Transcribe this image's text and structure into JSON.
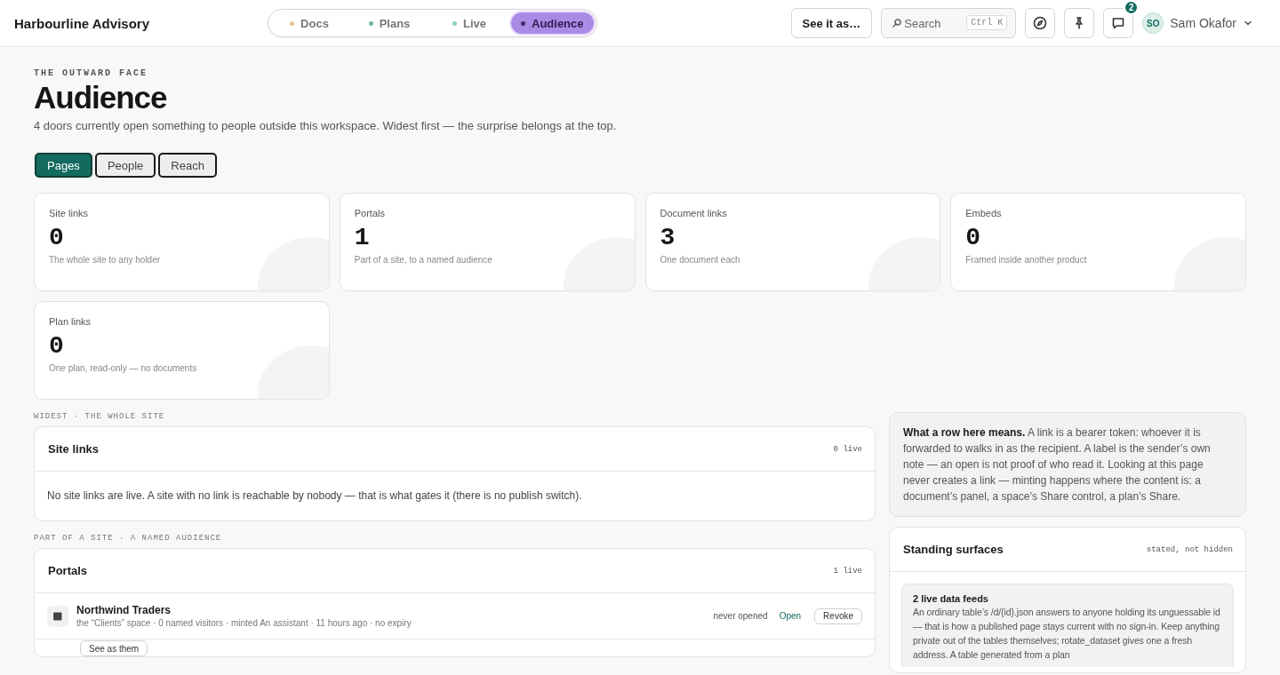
{
  "app": {
    "title": "Harbourline Advisory"
  },
  "nav_tabs": [
    {
      "label": "Docs",
      "selected": false,
      "color": "#e6c98c"
    },
    {
      "label": "Plans",
      "selected": false,
      "color": "#6fb8a3"
    },
    {
      "label": "Live",
      "selected": false,
      "color": "#86d3bd"
    },
    {
      "label": "Audience",
      "selected": true,
      "color": "#3b2a63"
    }
  ],
  "toolbar": {
    "see_as_button": "See it as…",
    "search": {
      "placeholder": "Search",
      "shortcut": "Ctrl K"
    },
    "notification_count": "2",
    "user": {
      "initials": "SO",
      "name": "Sam Okafor"
    }
  },
  "page": {
    "eyebrow": "THE OUTWARD FACE",
    "title": "Audience",
    "subtitle": "4 doors currently open something to people outside this workspace. Widest first — the surprise belongs at the top."
  },
  "view_tabs": [
    {
      "label": "Pages",
      "selected": true
    },
    {
      "label": "People",
      "selected": false
    },
    {
      "label": "Reach",
      "selected": false
    }
  ],
  "stats": [
    {
      "label": "Site links",
      "value": "0",
      "caption": "The whole site to any holder"
    },
    {
      "label": "Portals",
      "value": "1",
      "caption": "Part of a site, to a named audience"
    },
    {
      "label": "Document links",
      "value": "3",
      "caption": "One document each"
    },
    {
      "label": "Embeds",
      "value": "0",
      "caption": "Framed inside another product"
    },
    {
      "label": "Plan links",
      "value": "0",
      "caption": "One plan, read-only — no documents"
    }
  ],
  "sections": [
    {
      "eyebrow": "WIDEST · THE WHOLE SITE",
      "title": "Site links",
      "count": "0 live",
      "kind": "text",
      "body": "No site links are live. A site with no link is reachable by nobody — that is what gates it (there is no publish switch)."
    },
    {
      "eyebrow": "PART OF A SITE · A NAMED AUDIENCE",
      "title": "Portals",
      "count": "1 live",
      "kind": "rows",
      "rows": [
        {
          "name": "Northwind Traders",
          "meta": "the “Clients” space · 0 named visitors · minted An assistant · 11 hours ago · no expiry",
          "status": "never opened",
          "open_link": "Open",
          "revoke_button": "Revoke",
          "see_button": "See as them"
        }
      ]
    }
  ],
  "note": "**What a row here means.** A link is a bearer token: whoever it is forwarded to walks in as the recipient. A label is the sender’s own note — an open is not proof of who read it. Looking at this page never creates a link — minting happens where the content is: a document’s panel, a space’s Share control, a plan’s Share.",
  "standing": {
    "title": "Standing surfaces",
    "tag": "stated, not hidden",
    "items": [
      {
        "title": "2 live data feeds",
        "body": "An ordinary table’s /d/{id}.json answers to anyone holding its unguessable id — that is how a published page stays current with no sign-in. Keep anything private out of the tables themselves; rotate_dataset gives one a fresh address. A table generated from a plan"
      }
    ]
  }
}
